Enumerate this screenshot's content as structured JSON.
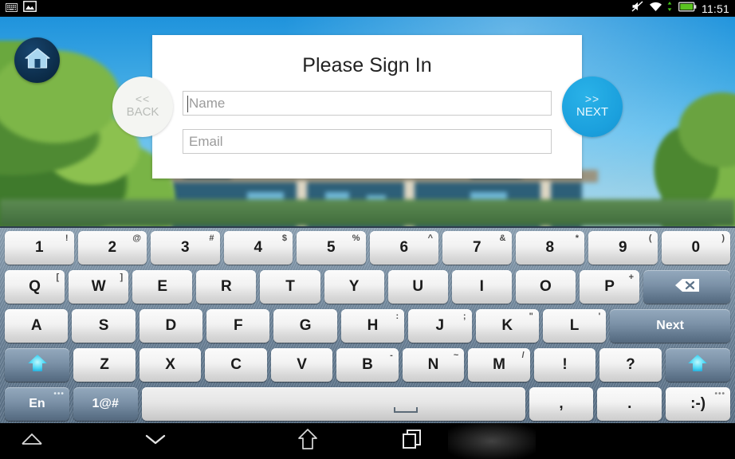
{
  "status_bar": {
    "left_icons": [
      {
        "name": "keyboard-icon",
        "label": "keyboard"
      },
      {
        "name": "picture-icon",
        "label": "screenshot"
      }
    ],
    "right_icons": [
      {
        "name": "mute-icon",
        "label": "sound off"
      },
      {
        "name": "wifi-icon",
        "label": "wifi"
      },
      {
        "name": "data-transfer-icon",
        "label": "data"
      },
      {
        "name": "battery-icon",
        "label": "battery"
      }
    ],
    "time": "11:51",
    "battery_color": "#5bc421"
  },
  "app": {
    "home_button": {
      "name": "home-icon",
      "label": "Home"
    },
    "card": {
      "title": "Please Sign In",
      "fields": [
        {
          "name": "name",
          "placeholder": "Name",
          "value": "",
          "focused": true
        },
        {
          "name": "email",
          "placeholder": "Email",
          "value": "",
          "focused": false
        }
      ]
    },
    "back_button": {
      "chevron": "<<",
      "label": "BACK",
      "color": "#f4f5f2"
    },
    "next_button": {
      "chevron": ">>",
      "label": "NEXT",
      "color": "#1ba0dd"
    }
  },
  "keyboard": {
    "rows": [
      {
        "id": "number-row",
        "keys": [
          {
            "label": "1",
            "sec": "!"
          },
          {
            "label": "2",
            "sec": "@"
          },
          {
            "label": "3",
            "sec": "#"
          },
          {
            "label": "4",
            "sec": "$"
          },
          {
            "label": "5",
            "sec": "%"
          },
          {
            "label": "6",
            "sec": "^"
          },
          {
            "label": "7",
            "sec": "&"
          },
          {
            "label": "8",
            "sec": "*"
          },
          {
            "label": "9",
            "sec": "("
          },
          {
            "label": "0",
            "sec": ")"
          }
        ]
      },
      {
        "id": "qwerty-row",
        "keys": [
          {
            "label": "Q",
            "sec": "["
          },
          {
            "label": "W",
            "sec": "]"
          },
          {
            "label": "E",
            "sec": ""
          },
          {
            "label": "R",
            "sec": ""
          },
          {
            "label": "T",
            "sec": ""
          },
          {
            "label": "Y",
            "sec": ""
          },
          {
            "label": "U",
            "sec": ""
          },
          {
            "label": "I",
            "sec": ""
          },
          {
            "label": "O",
            "sec": ""
          },
          {
            "label": "P",
            "sec": "+"
          },
          {
            "label": "",
            "sec": "",
            "style": "dark",
            "icon": "backspace-icon",
            "flex": 1.45
          }
        ]
      },
      {
        "id": "asdf-row",
        "keys": [
          {
            "label": "A",
            "sec": ""
          },
          {
            "label": "S",
            "sec": ""
          },
          {
            "label": "D",
            "sec": ""
          },
          {
            "label": "F",
            "sec": ""
          },
          {
            "label": "G",
            "sec": ""
          },
          {
            "label": "H",
            "sec": ":"
          },
          {
            "label": "J",
            "sec": ";"
          },
          {
            "label": "K",
            "sec": "\""
          },
          {
            "label": "L",
            "sec": "'"
          },
          {
            "label": "Next",
            "sec": "",
            "style": "dark",
            "flex": 1.9
          }
        ]
      },
      {
        "id": "zxcv-row",
        "keys": [
          {
            "label": "",
            "sec": "",
            "style": "dark",
            "icon": "shift-icon",
            "flex": 1.05
          },
          {
            "label": "Z",
            "sec": ""
          },
          {
            "label": "X",
            "sec": ""
          },
          {
            "label": "C",
            "sec": ""
          },
          {
            "label": "V",
            "sec": ""
          },
          {
            "label": "B",
            "sec": "-"
          },
          {
            "label": "N",
            "sec": "~"
          },
          {
            "label": "M",
            "sec": "/"
          },
          {
            "label": "!",
            "sec": ""
          },
          {
            "label": "?",
            "sec": ""
          },
          {
            "label": "",
            "sec": "",
            "style": "dark",
            "icon": "shift-icon",
            "flex": 1.05
          }
        ]
      },
      {
        "id": "bottom-row",
        "keys": [
          {
            "label": "En",
            "sec": "",
            "style": "dark",
            "dots": "•••",
            "flex": 1.0
          },
          {
            "label": "1@#",
            "sec": "",
            "style": "dark",
            "flex": 1.0
          },
          {
            "label": "",
            "sec": "",
            "style": "space",
            "icon": "space-icon",
            "flex": 5.95
          },
          {
            "label": ",",
            "sec": "",
            "flex": 1.0
          },
          {
            "label": ".",
            "sec": "",
            "flex": 1.0
          },
          {
            "label": ":-)",
            "sec": "",
            "dots": "•••",
            "flex": 1.0
          }
        ]
      }
    ]
  },
  "nav_bar": {
    "buttons": [
      {
        "name": "nav-menu-up-icon",
        "label": "menu"
      },
      {
        "name": "nav-hide-keyboard-icon",
        "label": "hide keyboard"
      },
      {
        "name": "nav-home-icon",
        "label": "home"
      },
      {
        "name": "nav-recents-icon",
        "label": "recent apps",
        "active": true
      }
    ]
  }
}
